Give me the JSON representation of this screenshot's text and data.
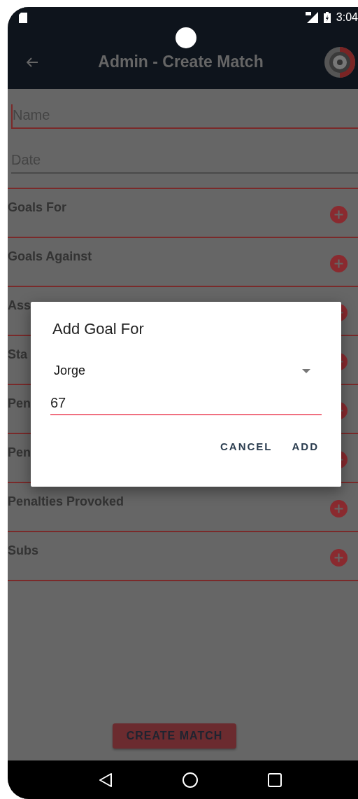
{
  "status_bar": {
    "time": "3:04"
  },
  "app_bar": {
    "title": "Admin - Create Match"
  },
  "fields": [
    {
      "placeholder": "Name",
      "focused": true
    },
    {
      "placeholder": "Date",
      "focused": false
    }
  ],
  "sections": [
    {
      "label": "Goals For"
    },
    {
      "label": "Goals Against"
    },
    {
      "label": "Ass"
    },
    {
      "label": "Sta"
    },
    {
      "label": "Pen"
    },
    {
      "label": "Pen"
    },
    {
      "label": "Penalties Provoked"
    },
    {
      "label": "Subs"
    }
  ],
  "dialog": {
    "title": "Add Goal For",
    "player": "Jorge",
    "minute": "67",
    "buttons": [
      "CANCEL",
      "ADD"
    ]
  },
  "create_button": "CREATE MATCH"
}
